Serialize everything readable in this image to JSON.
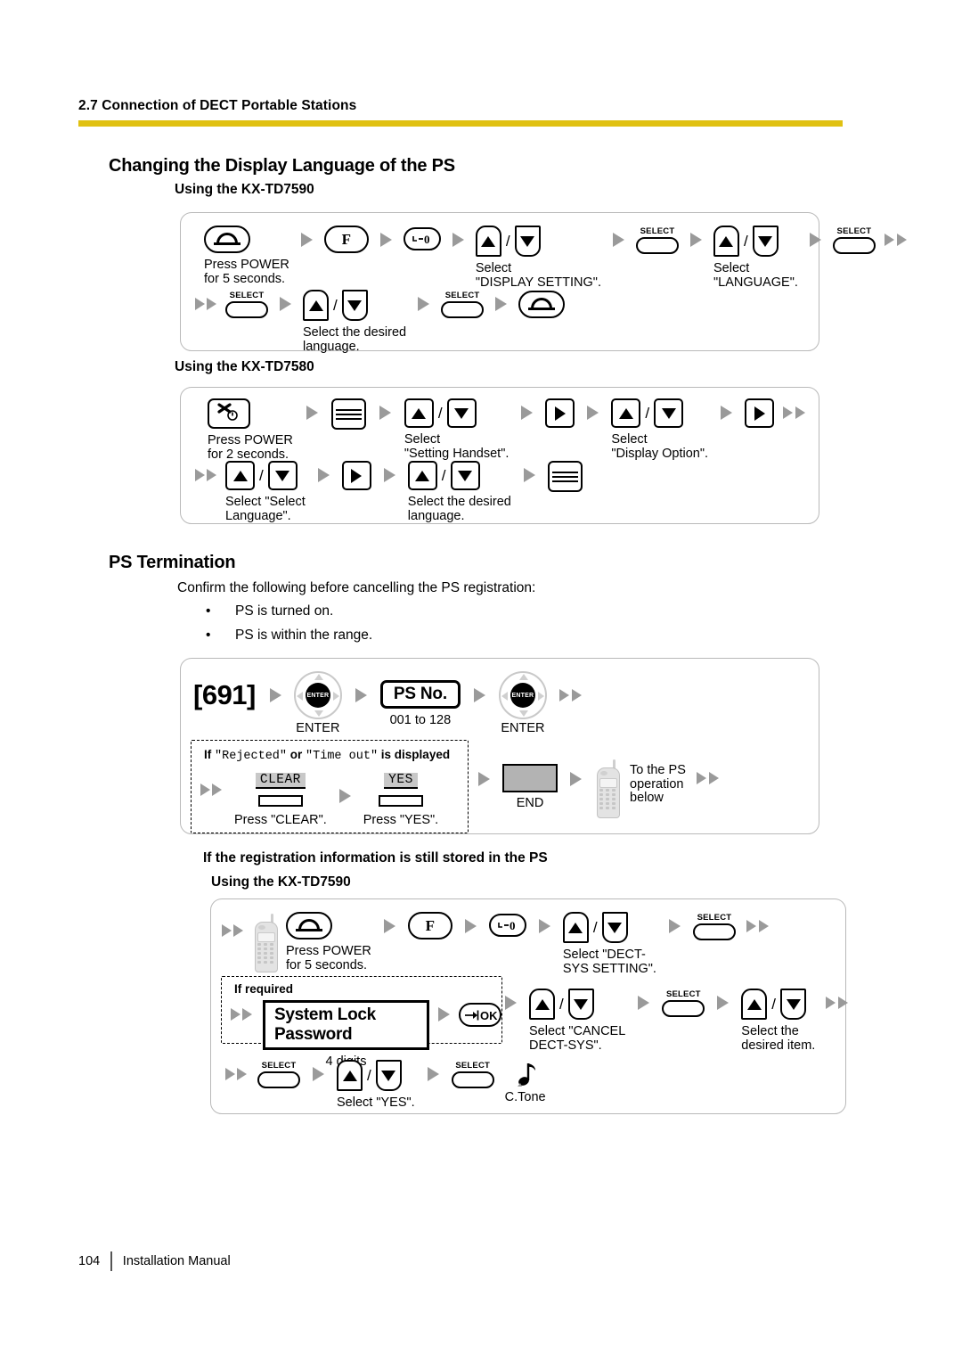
{
  "header": {
    "section": "2.7 Connection of DECT Portable Stations",
    "rule_color": "#e0c111"
  },
  "lang_section": {
    "title": "Changing the Display Language of the PS",
    "sub_7590": "Using the KX-TD7590",
    "sub_7580": "Using the KX-TD7580"
  },
  "flow_7590": {
    "keys": {
      "f": "F",
      "select": "SELECT"
    },
    "captions": {
      "power": "Press POWER\nfor 5 seconds.",
      "display_setting": "Select\n\"DISPLAY SETTING\".",
      "language": "Select\n\"LANGUAGE\".",
      "desired_language": "Select the desired\nlanguage."
    }
  },
  "flow_7580": {
    "captions": {
      "power": "Press POWER\nfor 2 seconds.",
      "setting_handset": "Select\n\"Setting Handset\".",
      "display_option": "Select\n\"Display Option\".",
      "select_language": "Select \"Select\nLanguage\".",
      "desired_language": "Select the desired\nlanguage."
    }
  },
  "ps_termination": {
    "title": "PS Termination",
    "intro": "Confirm the following before cancelling the PS registration:",
    "bullets": [
      "PS is turned on.",
      "PS is within the range."
    ],
    "code": "[691]",
    "enter_label": "ENTER",
    "enter_glyph": "ENTER",
    "ps_no": "PS No.",
    "ps_no_range": "001 to 128",
    "reject_box": {
      "title_a": "If ",
      "title_b": "\"Rejected\"",
      "title_c": " or ",
      "title_d": "\"Time out\"",
      "title_e": " is displayed",
      "clear_tag": "CLEAR",
      "clear_caption": "Press \"CLEAR\".",
      "yes_tag": "YES",
      "yes_caption": "Press \"YES\"."
    },
    "end_label": "END",
    "to_ps": "To the PS\noperation\nbelow"
  },
  "still_stored": {
    "title": "If the registration information is still stored in the PS",
    "sub": "Using the KX-TD7590",
    "keys": {
      "f": "F",
      "select": "SELECT",
      "ok": "OK"
    },
    "captions": {
      "power": "Press POWER\nfor 5 seconds.",
      "dect_sys": "Select \"DECT-\nSYS SETTING\".",
      "if_required": "If required",
      "lock_password": "System Lock Password",
      "four_digits": "4 digits",
      "cancel_dect": "Select \"CANCEL\nDECT-SYS\".",
      "desired_item": "Select the\ndesired item.",
      "select_yes": "Select \"YES\".",
      "ctone": "C.Tone"
    }
  },
  "footer": {
    "page": "104",
    "manual": "Installation Manual"
  }
}
